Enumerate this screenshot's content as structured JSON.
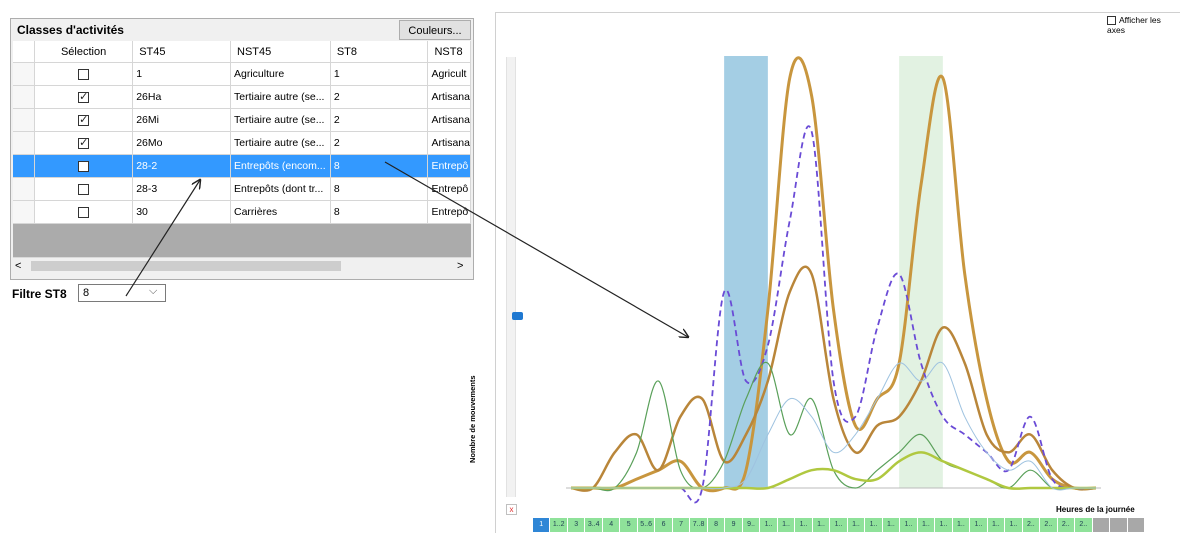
{
  "panel": {
    "title": "Classes d'activités",
    "colors_button": "Couleurs...",
    "columns": [
      "Sélection",
      "ST45",
      "NST45",
      "ST8",
      "NST8"
    ],
    "rows": [
      {
        "checked": false,
        "st45": "1",
        "nst45": "Agriculture",
        "st8": "1",
        "nst8": "Agricult",
        "selected": false
      },
      {
        "checked": true,
        "st45": "26Ha",
        "nst45": "Tertiaire autre (se...",
        "st8": "2",
        "nst8": "Artisana",
        "selected": false
      },
      {
        "checked": true,
        "st45": "26Mi",
        "nst45": "Tertiaire autre (se...",
        "st8": "2",
        "nst8": "Artisana",
        "selected": false
      },
      {
        "checked": true,
        "st45": "26Mo",
        "nst45": "Tertiaire autre (se...",
        "st8": "2",
        "nst8": "Artisana",
        "selected": false
      },
      {
        "checked": false,
        "st45": "28-2",
        "nst45": "Entrepôts (encom...",
        "st8": "8",
        "nst8": "Entrepô",
        "selected": true
      },
      {
        "checked": false,
        "st45": "28-3",
        "nst45": "Entrepôts (dont tr...",
        "st8": "8",
        "nst8": "Entrepô",
        "selected": false
      },
      {
        "checked": false,
        "st45": "30",
        "nst45": "Carrières",
        "st8": "8",
        "nst8": "Entrepô",
        "selected": false
      }
    ],
    "scroll_left": "<",
    "scroll_right": ">",
    "filter_label": "Filtre ST8",
    "filter_value": "8",
    "filter_chevron": "⌵"
  },
  "graph": {
    "axes_toggle_label": "Afficher les axes",
    "ylabel": "Nombre de mouvements",
    "xlabel": "Heures de la journée",
    "reset_icon": "x",
    "hour_labels": [
      "1",
      "1..2",
      "3",
      "3..4",
      "4",
      "5",
      "5..6",
      "6",
      "7",
      "7..8",
      "8",
      "9",
      "9..",
      "1..",
      "1..",
      "1..",
      "1..",
      "1..",
      "1..",
      "1..",
      "1..",
      "1..",
      "1..",
      "1..",
      "1..",
      "1..",
      "1..",
      "1..",
      "2..",
      "2..",
      "2..",
      "2..",
      "",
      "",
      ""
    ]
  },
  "chart_data": {
    "type": "line",
    "x": [
      0,
      1,
      2,
      3,
      4,
      5,
      6,
      7,
      8,
      9,
      10,
      11,
      12,
      13,
      14,
      15,
      16,
      17,
      18,
      19,
      20,
      21,
      22,
      23,
      24
    ],
    "highlight_bands": [
      {
        "from": 7.0,
        "to": 9.0,
        "color": "#7db9d8"
      },
      {
        "from": 15.0,
        "to": 17.0,
        "color": "#cfe9cf"
      }
    ],
    "series": [
      {
        "color": "#c8963e",
        "style": "solid",
        "values": [
          0,
          0,
          0,
          1,
          2,
          3,
          0,
          0,
          2,
          20,
          46,
          44,
          20,
          7,
          10,
          14,
          34,
          46,
          24,
          10,
          3,
          4,
          1,
          0,
          0
        ]
      },
      {
        "color": "#b9863a",
        "style": "solid",
        "values": [
          0,
          0,
          4,
          6,
          2,
          8,
          10,
          3,
          6,
          12,
          22,
          24,
          10,
          4,
          7,
          8,
          12,
          18,
          14,
          6,
          4,
          6,
          2,
          0,
          0
        ]
      },
      {
        "color": "#6a4bd6",
        "style": "dashed",
        "values": [
          0,
          0,
          0,
          0,
          0,
          0,
          0,
          22,
          12,
          16,
          30,
          40,
          12,
          8,
          18,
          24,
          14,
          8,
          6,
          4,
          2,
          8,
          1,
          0,
          0
        ]
      },
      {
        "color": "#5aa05a",
        "style": "solid",
        "values": [
          0,
          0,
          0,
          4,
          12,
          2,
          0,
          3,
          10,
          14,
          6,
          10,
          2,
          0,
          2,
          4,
          6,
          3,
          2,
          1,
          0,
          2,
          0,
          0,
          0
        ]
      },
      {
        "color": "#b0c840",
        "style": "solid",
        "values": [
          0,
          0,
          0,
          0,
          0,
          0,
          0,
          0,
          0,
          0,
          1,
          2,
          2,
          1,
          1,
          3,
          4,
          3,
          2,
          1,
          0,
          0,
          0,
          0,
          0
        ]
      },
      {
        "color": "#9fc3e0",
        "style": "solid",
        "values": [
          0,
          0,
          0,
          0,
          0,
          0,
          0,
          0,
          1,
          6,
          10,
          8,
          4,
          6,
          10,
          14,
          12,
          14,
          8,
          4,
          2,
          3,
          0,
          0,
          0
        ]
      }
    ],
    "grid": false
  }
}
